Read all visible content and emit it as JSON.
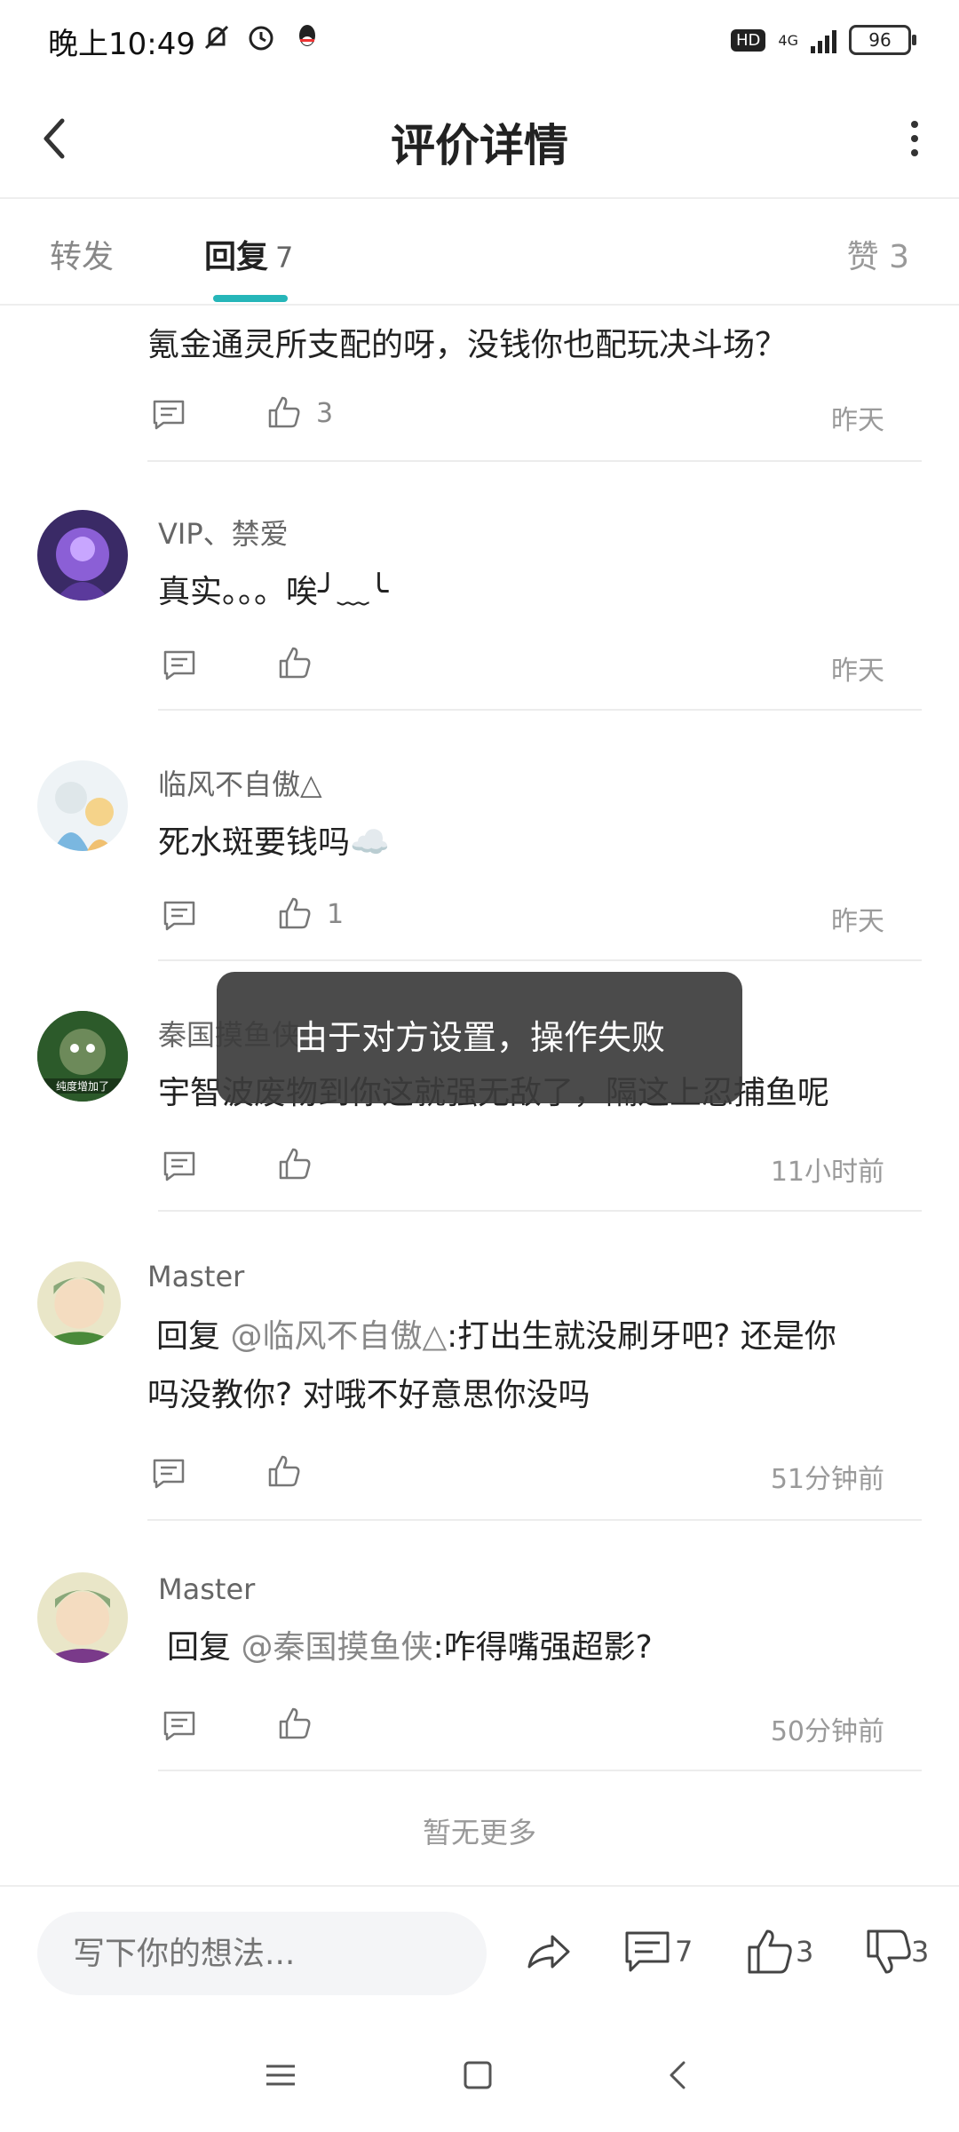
{
  "status_bar": {
    "time": "晚上10:49",
    "hd": "HD",
    "network": "4G",
    "battery": "96"
  },
  "header": {
    "title": "评价详情"
  },
  "tabs": {
    "forward": "转发",
    "reply": "回复",
    "reply_count": "7",
    "like": "赞 3"
  },
  "comments": [
    {
      "name": "",
      "text": "氪金通灵所支配的呀，没钱你也配玩决斗场？",
      "likes": "3",
      "time": "昨天"
    },
    {
      "name": "VIP、禁爱",
      "text": "真实。。。唉╯﹏╰",
      "likes": "",
      "time": "昨天"
    },
    {
      "name": "临风不自傲△",
      "text": "死水斑要钱吗☁️",
      "likes": "1",
      "time": "昨天"
    },
    {
      "name": "秦国摸鱼侠",
      "text": "宇智波废物到你这就强无敌了，隔这上忍捕鱼呢",
      "likes": "",
      "time": "11小时前",
      "avatar_caption": "纯度增加了"
    },
    {
      "name": "Master",
      "reply_prefix": "回复",
      "mention": "@临风不自傲△",
      "text_line1": ":打出生就没刷牙吧? 还是你",
      "text_line2": "吗没教你? 对哦不好意思你没吗",
      "likes": "",
      "time": "51分钟前"
    },
    {
      "name": "Master",
      "reply_prefix": "回复",
      "mention": "@秦国摸鱼侠",
      "text": ":咋得嘴强超影?",
      "likes": "",
      "time": "50分钟前"
    }
  ],
  "no_more": "暂无更多",
  "toast": "由于对方设置，操作失败",
  "bottom_bar": {
    "placeholder": "写下你的想法...",
    "comment_count": "7",
    "like_count": "3",
    "dislike_count": "3"
  },
  "colors": {
    "accent": "#26b6b9"
  }
}
